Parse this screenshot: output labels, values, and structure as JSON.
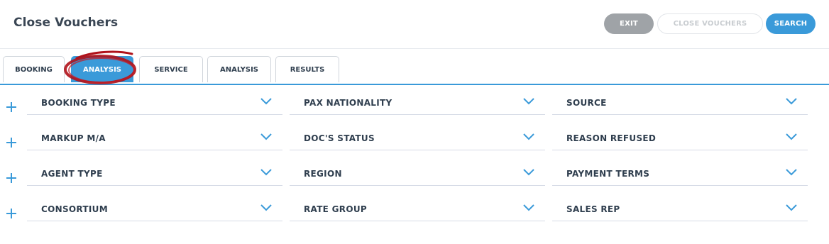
{
  "header": {
    "title": "Close Vouchers"
  },
  "buttons": {
    "exit": "EXIT",
    "close_vouchers": "CLOSE VOUCHERS",
    "search": "SEARCH"
  },
  "tabs": [
    {
      "label": "BOOKING",
      "active": false
    },
    {
      "label": "ANALYSIS",
      "active": true
    },
    {
      "label": "SERVICE",
      "active": false
    },
    {
      "label": "ANALYSIS",
      "active": false
    },
    {
      "label": "RESULTS",
      "active": false
    }
  ],
  "fields": {
    "col1": [
      "BOOKING TYPE",
      "MARKUP M/A",
      "AGENT TYPE",
      "CONSORTIUM"
    ],
    "col2": [
      "PAX NATIONALITY",
      "DOC'S STATUS",
      "REGION",
      "RATE GROUP"
    ],
    "col3": [
      "SOURCE",
      "REASON REFUSED",
      "PAYMENT TERMS",
      "SALES REP"
    ]
  },
  "colors": {
    "accent": "#3a9ad9",
    "exit_button": "#9fa3a7",
    "annotation": "#b0121a"
  },
  "icons": {
    "add": "plus-icon",
    "expand": "chevron-down-icon"
  }
}
